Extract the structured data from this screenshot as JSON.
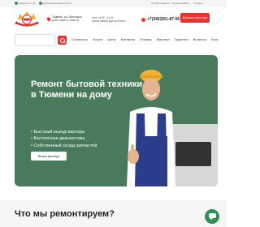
{
  "topbar": {
    "badges": [
      "Гарантия 1 год",
      "Бесплатная диагностика"
    ],
    "links": [
      "Оплата ремонта",
      "Оплата работы",
      "Отзывы"
    ]
  },
  "header": {
    "address": "Тюмень, ул. Шиллера, д.46, корп.3, пом.13",
    "hours_line1": "пн-пт: 9:00 - 21:00",
    "hours_line2": "прием заявок круглосуточно",
    "phone": "+7(3452)51-87-56",
    "call_button": "Вызвать мастера"
  },
  "nav": {
    "items": [
      "Стоимость",
      "Услуги",
      "Цены",
      "Контакты",
      "Отзывы",
      "Мастера",
      "Гарантия",
      "Вопросы",
      "Блог"
    ]
  },
  "hero": {
    "title": "Ремонт бытовой техники в Тюмени на дому",
    "bullets": [
      "• Быстрый выезд мастера",
      "• Бесплатная диагностика",
      "• Собственный склад запчастей"
    ],
    "button": "Вызов мастера"
  },
  "services": {
    "title": "Что мы ремонтируем?"
  },
  "colors": {
    "accent": "#e8342e",
    "hero_bg": "#4a7a5c",
    "chat": "#2f8f52"
  }
}
